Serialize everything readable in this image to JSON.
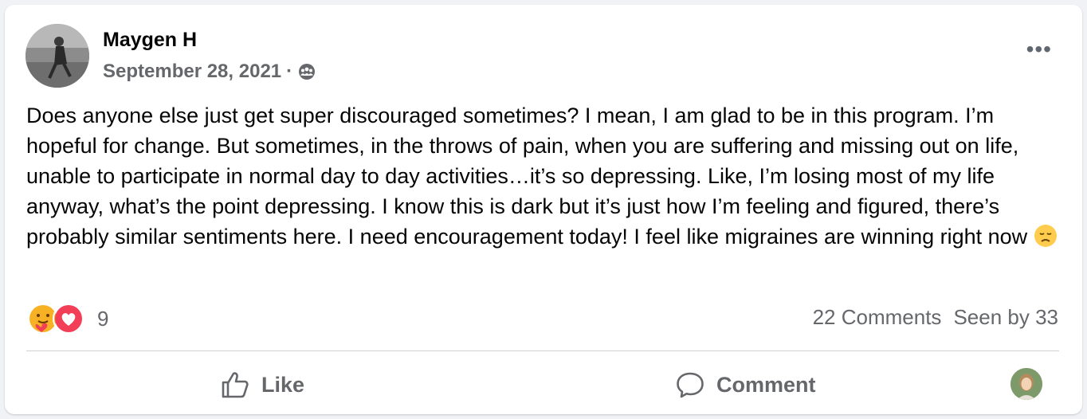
{
  "post": {
    "author": "Maygen H",
    "date": "September 28, 2021",
    "separator": "·",
    "audience_icon": "group-icon",
    "more_label": "•••",
    "body": "Does anyone else just get super discouraged sometimes? I mean, I am glad to be in this program. I’m hopeful for change. But sometimes, in the throws of pain, when you are suffering and missing out on life, unable to participate in normal day to day activities…it’s so depressing. Like, I’m losing most of my life anyway, what’s the point depressing. I know this is dark but it’s just how I’m feeling and figured, there’s probably similar sentiments here. I need encouragement today! I feel like migraines are winning right now",
    "body_emoji": "disappointed-face-emoji"
  },
  "reactions": {
    "icons": [
      "care-reaction-icon",
      "love-reaction-icon"
    ],
    "count": "9"
  },
  "stats": {
    "comments": "22 Comments",
    "seen_by": "Seen by 33"
  },
  "actions": {
    "like_label": "Like",
    "comment_label": "Comment"
  },
  "colors": {
    "text": "#050505",
    "secondary": "#65676b",
    "love": "#f33e58",
    "care": "#f7b125",
    "card_bg": "#ffffff",
    "page_bg": "#f0f2f5"
  }
}
